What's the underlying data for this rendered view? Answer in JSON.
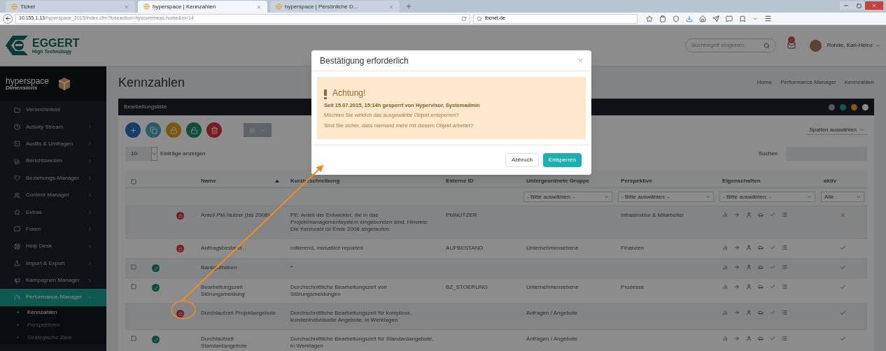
{
  "browser": {
    "tabs": [
      {
        "title": "Ticket",
        "selected": false
      },
      {
        "title": "hyperspace | Kennzahlen",
        "selected": true
      },
      {
        "title": "hyperspace | Persönliche D...",
        "selected": false
      }
    ],
    "address": {
      "host": "10.155.1.13",
      "path": "/hyperspace_2015/index.cfm?fuseaction=hyscoremeas.home&m=14"
    },
    "search": "tbcnet.de"
  },
  "header": {
    "logo": {
      "name": "EGGERT",
      "tagline": "High Technology"
    },
    "search_placeholder": "Suchbegriff eingeben",
    "user": "Rohde, Karl-Heinz"
  },
  "sidebar": {
    "brand": {
      "name": "hyperspace",
      "subtitle": "Dimensions"
    },
    "items": [
      {
        "label": "Verzeichnisse",
        "selected": false,
        "has_caret": false
      },
      {
        "label": "Activity Stream",
        "selected": false,
        "has_caret": true
      },
      {
        "label": "Audits & Umfragen",
        "selected": false,
        "has_caret": true
      },
      {
        "label": "Berichtswesen",
        "selected": false,
        "has_caret": true
      },
      {
        "label": "Beziehungs-Manager",
        "selected": false,
        "has_caret": true
      },
      {
        "label": "Content Manager",
        "selected": false,
        "has_caret": true
      },
      {
        "label": "Extras",
        "selected": false,
        "has_caret": true
      },
      {
        "label": "Foren",
        "selected": false,
        "has_caret": true
      },
      {
        "label": "Help Desk",
        "selected": false,
        "has_caret": true
      },
      {
        "label": "Import & Export",
        "selected": false,
        "has_caret": true
      },
      {
        "label": "Kampagnen Manager",
        "selected": false,
        "has_caret": true
      },
      {
        "label": "Performance-Manager",
        "selected": true,
        "has_caret": true,
        "expanded": true,
        "children": [
          {
            "label": "Kennzahlen",
            "selected": true
          },
          {
            "label": "Perspektiven",
            "selected": false
          },
          {
            "label": "Strategische Ziele",
            "selected": false
          }
        ]
      }
    ]
  },
  "page": {
    "title": "Kennzahlen",
    "breadcrumbs": [
      "Home",
      "Performance Manager",
      "Kennzahlen"
    ]
  },
  "panel": {
    "title": "Bearbeitungsliste",
    "columns_button": "Spalten auswählen",
    "page_length": "10",
    "page_length_label": "Einträge anzeigen",
    "search_label": "Suchen",
    "table": {
      "columns": [
        {
          "kind": "checkbox"
        },
        {
          "kind": "blank"
        },
        {
          "kind": "blank"
        },
        {
          "label": "Name",
          "kind": "sorted"
        },
        {
          "label": "Kurzbeschreibung",
          "kind": "text"
        },
        {
          "label": "Externe ID",
          "kind": "text"
        },
        {
          "label": "Untergeordnete Gruppe",
          "kind": "text",
          "filter": "- Bitte auswählen: -"
        },
        {
          "label": "Perspektive",
          "kind": "text",
          "filter": "- Bitte auswählen: -"
        },
        {
          "label": "Eigenschaften",
          "kind": "text",
          "filter": "- Bitte auswählen: -"
        },
        {
          "label": "aktiv",
          "kind": "text",
          "filter": "Alle"
        }
      ],
      "rows": [
        {
          "kind": "locked",
          "name": "Anteil PM-Nutzer (bis 2008)",
          "description": "PE: Anteil der Entwickler, die in das Projektmanagementsystem eingebunden sind. Hinweis: Die Kennzahl ist Ende 2008 abgelaufen.",
          "external_id": "PMNUTZER",
          "perspective": "Infrastruktur & Mitarbeiter",
          "active": false
        },
        {
          "kind": "locked",
          "name": "Auftragsbestand",
          "description": "rollierend, monatlich reported",
          "external_id": "AUFBESTAND",
          "group": "Unternehmensebene",
          "perspective": "Finanzen",
          "active": true
        },
        {
          "kind": "editable",
          "name": "Bankguthaben",
          "description": "*",
          "active": true
        },
        {
          "kind": "editable",
          "name": "Bearbeitungszeit Störungsmeldung",
          "description": "Durchschnittliche Bearbeitungszeit von Störungsmeldungen",
          "external_id": "BZ_STOERUNG",
          "group": "Unternehmensebene",
          "perspective": "Prozesse",
          "active": true
        },
        {
          "kind": "locked",
          "name": "Durchlaufzeit Projektangebote",
          "description": "Durchschnittliche Bearbeitungszeit für komplexe, kundenindividuelle Angebote, in Werktagen",
          "group": "Anfragen / Angebote",
          "active": true
        },
        {
          "kind": "editable",
          "name": "Durchlaufzeit Standardangebote",
          "description": "Durchschnittliche Bearbeitungszeit für Standardangebote, in Werktagen",
          "group": "Anfragen / Angebote",
          "active": true
        }
      ]
    }
  },
  "dialog": {
    "title": "Bestätigung erforderlich",
    "close": "×",
    "alert": {
      "heading": "Achtung!",
      "lock_info": "Seit 15.07.2015, 15:14h gesperrt von Hypervisor, Systemadmin",
      "lines": [
        "Möchten Sie wirklich das ausgewählte Objekt entsperren?",
        "Sind Sie sicher, dass niemand mehr mit diesem Objekt arbeitet?"
      ]
    },
    "buttons": [
      {
        "label": "Abbruch",
        "kind": "default"
      },
      {
        "label": "Entsperren",
        "kind": "primary"
      }
    ]
  }
}
